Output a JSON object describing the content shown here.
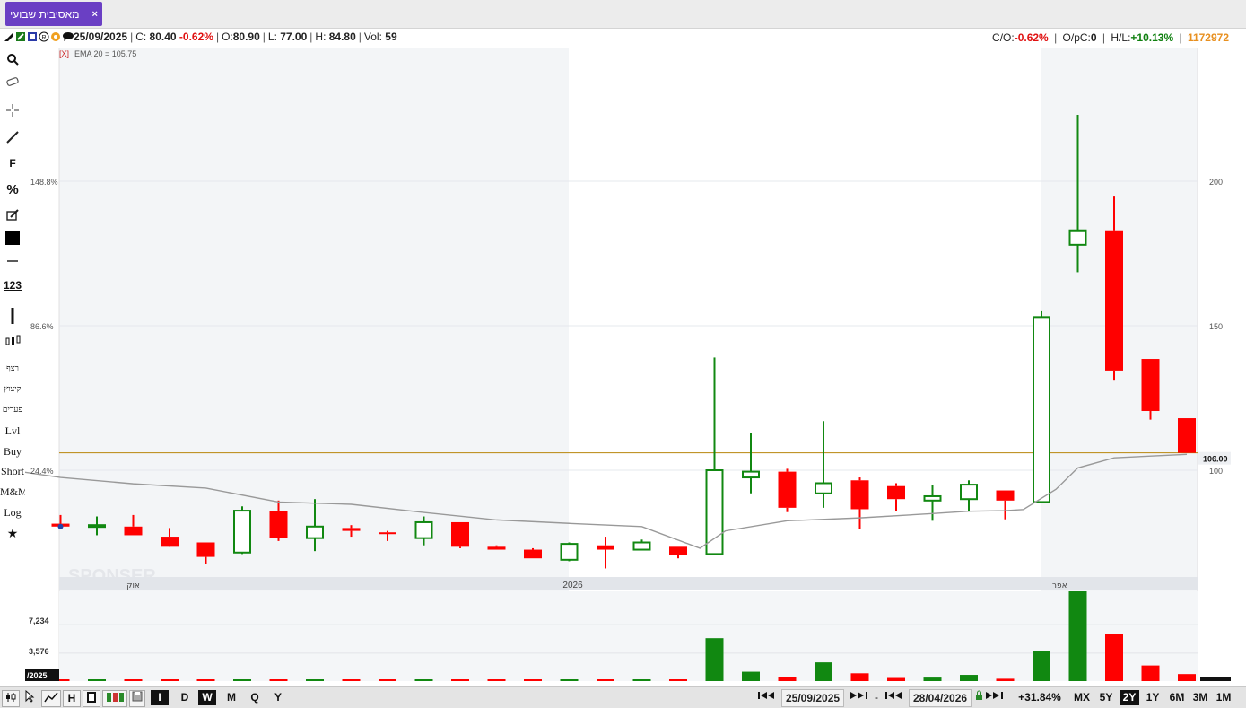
{
  "tab": {
    "title": "מאסיבית שבועי",
    "close": "×"
  },
  "info": {
    "date": "25/09/2025",
    "close_label": "C:",
    "close": "80.40",
    "change": "-0.62%",
    "open_label": "O:",
    "open": "80.90",
    "low_label": "L:",
    "low": "77.00",
    "high_label": "H:",
    "high": "84.80",
    "vol_label": "Vol:",
    "vol": "59",
    "co_label": "C/O:",
    "co": "-0.62%",
    "opc_label": "O/pC:",
    "opc": "0",
    "hl_label": "H/L:",
    "hl": "+10.13%",
    "id": "1172972"
  },
  "toolbar": {
    "items": [
      "רצף",
      "קיצוץ",
      "פערים",
      "Lvl",
      "Buy",
      "Short",
      "M&M",
      "Log"
    ],
    "f_label": "F",
    "pct_label": "%",
    "num_label": "123"
  },
  "bottom": {
    "periods": [
      "I",
      "D",
      "W",
      "M",
      "Q",
      "Y"
    ],
    "active_period": "W",
    "date_from": "25/09/2025",
    "dash": "-",
    "date_to": "28/04/2026",
    "change": "+31.84%",
    "ranges": [
      "MX",
      "5Y",
      "2Y",
      "1Y",
      "6M",
      "3M",
      "1M"
    ],
    "active_range": "2Y"
  },
  "colors": {
    "up": "#118811",
    "down": "#ff0000",
    "ema": "#999999",
    "level": "#b8860b",
    "accent": "#6a3fc4"
  },
  "chart_data": {
    "type": "candlestick",
    "indicator_label": "[X]",
    "indicator": "EMA 20 = 105.75",
    "y_ticks_right": [
      100,
      150,
      200
    ],
    "y_ticks_left": [
      "24.4%",
      "86.6%",
      "148.8%"
    ],
    "last_price_label": "106.00",
    "level_line": 106.0,
    "x_labels": [
      "אוק",
      "2026",
      "אפר"
    ],
    "watermark": "SPONSER",
    "candles": [
      {
        "o": 81.5,
        "h": 84.5,
        "l": 79.5,
        "c": 80.5
      },
      {
        "o": 81.0,
        "h": 84.0,
        "l": 77.5,
        "c": 81.0
      },
      {
        "o": 80.5,
        "h": 84.5,
        "l": 77.5,
        "c": 77.5
      },
      {
        "o": 77.0,
        "h": 80.0,
        "l": 74.5,
        "c": 73.5
      },
      {
        "o": 75.0,
        "h": 75.0,
        "l": 67.5,
        "c": 70.0
      },
      {
        "o": 71.5,
        "h": 87.5,
        "l": 71.0,
        "c": 86.0
      },
      {
        "o": 86.0,
        "h": 89.5,
        "l": 75.5,
        "c": 76.5
      },
      {
        "o": 76.5,
        "h": 90.0,
        "l": 72.0,
        "c": 80.5
      },
      {
        "o": 80.0,
        "h": 81.0,
        "l": 77.0,
        "c": 79.0
      },
      {
        "o": 78.5,
        "h": 79.0,
        "l": 75.5,
        "c": 78.0
      },
      {
        "o": 76.5,
        "h": 84.0,
        "l": 74.0,
        "c": 82.0
      },
      {
        "o": 82.0,
        "h": 82.0,
        "l": 73.0,
        "c": 73.5
      },
      {
        "o": 73.5,
        "h": 74.0,
        "l": 72.5,
        "c": 72.5
      },
      {
        "o": 72.5,
        "h": 73.0,
        "l": 69.5,
        "c": 69.5
      },
      {
        "o": 69.0,
        "h": 75.0,
        "l": 68.5,
        "c": 74.5
      },
      {
        "o": 74.0,
        "h": 77.0,
        "l": 66.0,
        "c": 72.5
      },
      {
        "o": 72.5,
        "h": 76.0,
        "l": 72.5,
        "c": 75.0
      },
      {
        "o": 73.5,
        "h": 73.5,
        "l": 69.5,
        "c": 70.5
      },
      {
        "o": 71.0,
        "h": 139.0,
        "l": 71.0,
        "c": 100.0
      },
      {
        "o": 97.5,
        "h": 113.0,
        "l": 92.0,
        "c": 99.5
      },
      {
        "o": 99.5,
        "h": 100.5,
        "l": 85.5,
        "c": 87.0
      },
      {
        "o": 92.0,
        "h": 117.0,
        "l": 87.0,
        "c": 95.5
      },
      {
        "o": 96.5,
        "h": 97.5,
        "l": 79.5,
        "c": 86.5
      },
      {
        "o": 94.5,
        "h": 95.5,
        "l": 86.0,
        "c": 90.0
      },
      {
        "o": 89.5,
        "h": 95.0,
        "l": 82.5,
        "c": 91.0
      },
      {
        "o": 90.0,
        "h": 96.5,
        "l": 86.0,
        "c": 95.0
      },
      {
        "o": 93.0,
        "h": 93.0,
        "l": 83.0,
        "c": 89.5
      },
      {
        "o": 89.0,
        "h": 155.0,
        "l": 89.0,
        "c": 153.0
      },
      {
        "o": 178.0,
        "h": 223.0,
        "l": 168.5,
        "c": 183.0
      },
      {
        "o": 183.0,
        "h": 195.0,
        "l": 131.0,
        "c": 134.5
      },
      {
        "o": 138.5,
        "h": 138.5,
        "l": 117.5,
        "c": 120.5
      },
      {
        "o": 118.0,
        "h": 118.0,
        "l": 106.0,
        "c": 106.0
      }
    ],
    "ema": [
      97.5,
      95.3,
      93.8,
      89.0,
      88.2,
      85.4,
      82.8,
      81.6,
      80.5,
      73.0,
      79.0,
      82.5,
      83.5,
      85.0,
      85.8,
      86.0,
      86.4,
      93.4,
      100.8,
      104.3,
      105.5
    ],
    "ema_x": [
      0,
      2,
      4,
      6,
      8,
      10,
      12,
      14,
      16,
      17.6,
      18.3,
      20,
      22,
      24,
      25,
      26,
      26.5,
      27.4,
      28,
      29,
      31
    ],
    "volume_ticks": [
      "3,576",
      "7,234"
    ],
    "volume_corner_label": "/2025",
    "volume": [
      50,
      60,
      60,
      60,
      90,
      60,
      90,
      90,
      60,
      60,
      90,
      60,
      60,
      60,
      60,
      60,
      60,
      60,
      5500,
      1200,
      500,
      2400,
      1000,
      400,
      450,
      800,
      300,
      3900,
      11500,
      6000,
      2000,
      900
    ]
  }
}
